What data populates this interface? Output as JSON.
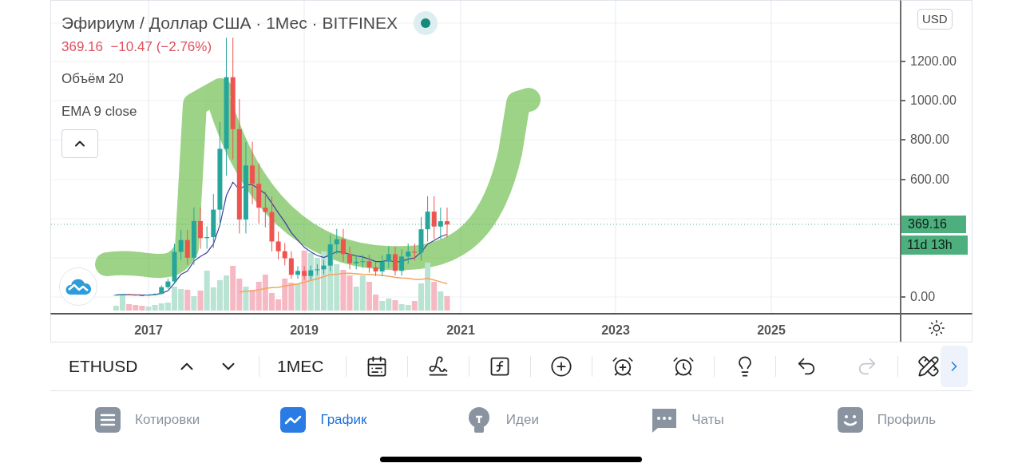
{
  "header": {
    "title": "Эфириум / Доллар США · 1Мес · BITFINEX",
    "live": true,
    "quote": "369.16  −10.47 (−2.76%)",
    "falling": true
  },
  "indicators": [
    {
      "label": "Объём 20"
    },
    {
      "label": "EMA 9 close"
    }
  ],
  "price_axis": {
    "currency": "USD",
    "labels": [
      "1200.00",
      "1000.00",
      "800.00",
      "600.00",
      "0.00"
    ],
    "last_price": "369.16",
    "countdown": "11d 13h"
  },
  "time_axis": {
    "labels": [
      "2017",
      "2019",
      "2021",
      "2023",
      "2025"
    ]
  },
  "toolbar": {
    "symbol": "ETHUSD",
    "interval": "1МЕС",
    "tools": [
      {
        "kind": "calendar",
        "disabled": false
      },
      {
        "kind": "draw",
        "disabled": false
      },
      {
        "kind": "function",
        "disabled": false
      },
      {
        "kind": "add",
        "disabled": false
      },
      {
        "kind": "alert-add",
        "disabled": false
      },
      {
        "kind": "alert-list",
        "disabled": false
      },
      {
        "kind": "idea",
        "disabled": false
      },
      {
        "kind": "undo",
        "disabled": false
      },
      {
        "kind": "redo",
        "disabled": true
      },
      {
        "kind": "tools",
        "disabled": false
      }
    ]
  },
  "nav": [
    {
      "label": "Котировки",
      "selected": false
    },
    {
      "label": "График",
      "selected": true
    },
    {
      "label": "Идеи",
      "selected": false
    },
    {
      "label": "Чаты",
      "selected": false
    },
    {
      "label": "Профиль",
      "selected": false
    }
  ]
}
